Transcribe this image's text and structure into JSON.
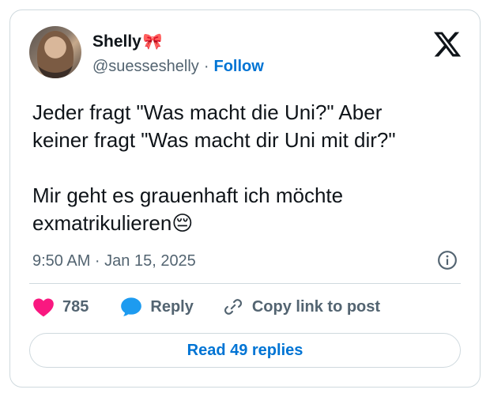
{
  "user": {
    "name": "Shelly",
    "name_emoji": "🎀",
    "handle": "@suesseshelly",
    "separator": "·",
    "follow_label": "Follow"
  },
  "tweet": {
    "text": "Jeder fragt \"Was macht die Uni?\" Aber\nkeiner fragt \"Was macht dir Uni mit dir?\"\n\nMir geht es grauenhaft ich möchte\nexmatrikulieren😔",
    "timestamp": "9:50 AM · Jan 15, 2025"
  },
  "actions": {
    "likes_count": "785",
    "reply_label": "Reply",
    "copy_label": "Copy link to post"
  },
  "footer": {
    "read_replies_label": "Read 49 replies"
  },
  "colors": {
    "accent": "#0074d4",
    "like": "#f91880",
    "reply_bubble": "#1d9bf0",
    "muted": "#536471",
    "border": "#cfd9de"
  },
  "icons": [
    "x-logo-icon",
    "info-icon",
    "heart-icon",
    "speech-bubble-icon",
    "link-icon"
  ]
}
